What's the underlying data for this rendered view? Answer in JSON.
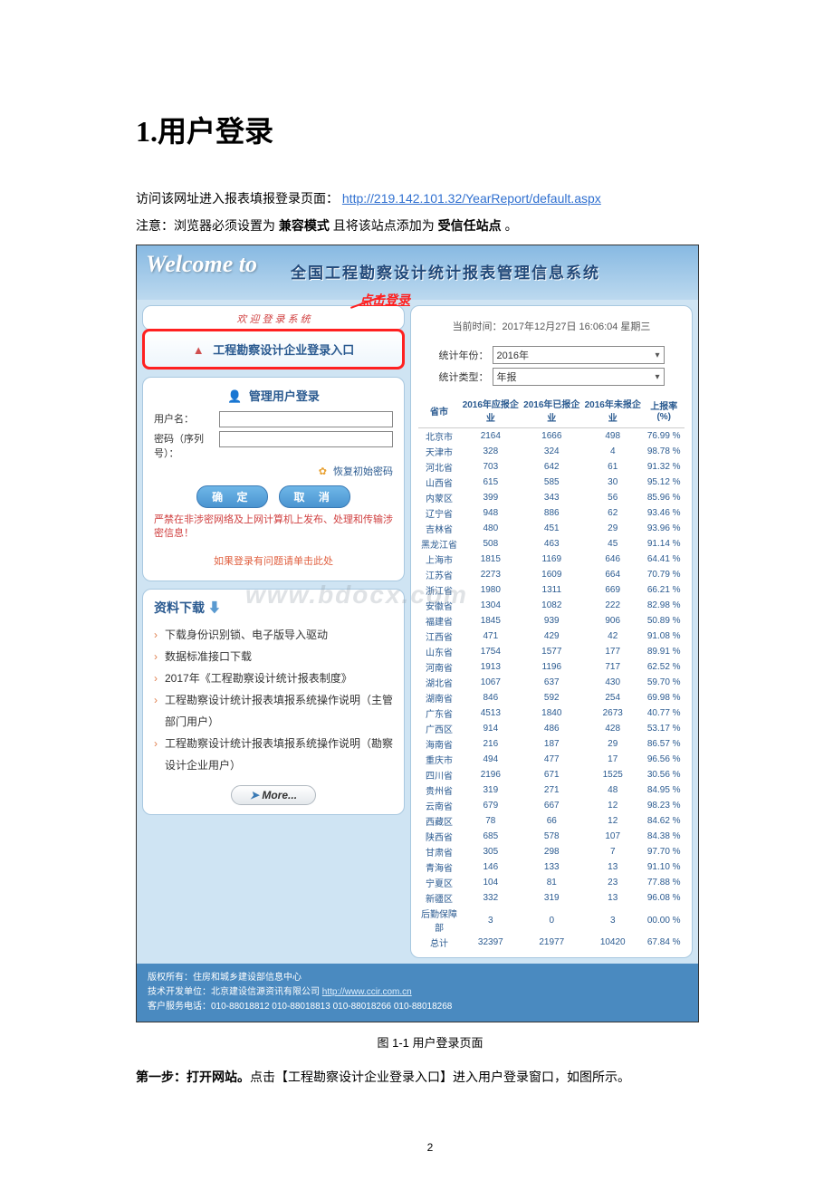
{
  "doc": {
    "heading": "1.用户登录",
    "intro1_prefix": "访问该网址进入报表填报登录页面：",
    "intro1_link": "http://219.142.101.32/YearReport/default.aspx",
    "intro2_prefix": "注意：浏览器必须设置为",
    "intro2_bold1": "兼容模式",
    "intro2_mid": "且将该站点添加为",
    "intro2_bold2": "受信任站点",
    "intro2_suffix": "。",
    "caption": "图 1-1  用户登录页面",
    "step_bold": "第一步：打开网站。",
    "step_rest": "点击【工程勘察设计企业登录入口】进入用户登录窗口，如图所示。",
    "page_num": "2"
  },
  "banner": {
    "welcome": "Welcome to",
    "system_title": "全国工程勘察设计统计报表管理信息系统"
  },
  "login_entry": {
    "label": "工程勘察设计企业登录入口",
    "callout": "点击登录",
    "welcome_strip": "欢 迎 登 录 系 统"
  },
  "admin_login": {
    "title": "管理用户登录",
    "username_label": "用户名：",
    "password_label": "密码（序列号）：",
    "reset_pw": "恢复初始密码",
    "confirm_btn": "确  定",
    "cancel_btn": "取  消",
    "warn": "严禁在非涉密网络及上网计算机上发布、处理和传输涉密信息！",
    "help": "如果登录有问题请单击此处"
  },
  "watermark": "www.bdocx.com",
  "downloads": {
    "title": "资料下载",
    "items": [
      "下载身份识别锁、电子版导入驱动",
      "数据标准接口下载",
      "2017年《工程勘察设计统计报表制度》",
      "工程勘察设计统计报表填报系统操作说明（主管部门用户）",
      "工程勘察设计统计报表填报系统操作说明（勘察设计企业用户）"
    ],
    "more": "More..."
  },
  "right": {
    "current_time": "当前时间：2017年12月27日 16:06:04 星期三",
    "year_label": "统计年份：",
    "year_value": "2016年",
    "type_label": "统计类型：",
    "type_value": "年报",
    "headers": [
      "省市",
      "2016年应报企业",
      "2016年已报企业",
      "2016年未报企业",
      "上报率(%)"
    ],
    "rows": [
      [
        "北京市",
        "2164",
        "1666",
        "498",
        "76.99 %"
      ],
      [
        "天津市",
        "328",
        "324",
        "4",
        "98.78 %"
      ],
      [
        "河北省",
        "703",
        "642",
        "61",
        "91.32 %"
      ],
      [
        "山西省",
        "615",
        "585",
        "30",
        "95.12 %"
      ],
      [
        "内蒙区",
        "399",
        "343",
        "56",
        "85.96 %"
      ],
      [
        "辽宁省",
        "948",
        "886",
        "62",
        "93.46 %"
      ],
      [
        "吉林省",
        "480",
        "451",
        "29",
        "93.96 %"
      ],
      [
        "黑龙江省",
        "508",
        "463",
        "45",
        "91.14 %"
      ],
      [
        "上海市",
        "1815",
        "1169",
        "646",
        "64.41 %"
      ],
      [
        "江苏省",
        "2273",
        "1609",
        "664",
        "70.79 %"
      ],
      [
        "浙江省",
        "1980",
        "1311",
        "669",
        "66.21 %"
      ],
      [
        "安徽省",
        "1304",
        "1082",
        "222",
        "82.98 %"
      ],
      [
        "福建省",
        "1845",
        "939",
        "906",
        "50.89 %"
      ],
      [
        "江西省",
        "471",
        "429",
        "42",
        "91.08 %"
      ],
      [
        "山东省",
        "1754",
        "1577",
        "177",
        "89.91 %"
      ],
      [
        "河南省",
        "1913",
        "1196",
        "717",
        "62.52 %"
      ],
      [
        "湖北省",
        "1067",
        "637",
        "430",
        "59.70 %"
      ],
      [
        "湖南省",
        "846",
        "592",
        "254",
        "69.98 %"
      ],
      [
        "广东省",
        "4513",
        "1840",
        "2673",
        "40.77 %"
      ],
      [
        "广西区",
        "914",
        "486",
        "428",
        "53.17 %"
      ],
      [
        "海南省",
        "216",
        "187",
        "29",
        "86.57 %"
      ],
      [
        "重庆市",
        "494",
        "477",
        "17",
        "96.56 %"
      ],
      [
        "四川省",
        "2196",
        "671",
        "1525",
        "30.56 %"
      ],
      [
        "贵州省",
        "319",
        "271",
        "48",
        "84.95 %"
      ],
      [
        "云南省",
        "679",
        "667",
        "12",
        "98.23 %"
      ],
      [
        "西藏区",
        "78",
        "66",
        "12",
        "84.62 %"
      ],
      [
        "陕西省",
        "685",
        "578",
        "107",
        "84.38 %"
      ],
      [
        "甘肃省",
        "305",
        "298",
        "7",
        "97.70 %"
      ],
      [
        "青海省",
        "146",
        "133",
        "13",
        "91.10 %"
      ],
      [
        "宁夏区",
        "104",
        "81",
        "23",
        "77.88 %"
      ],
      [
        "新疆区",
        "332",
        "319",
        "13",
        "96.08 %"
      ],
      [
        "后勤保障部",
        "3",
        "0",
        "3",
        "00.00 %"
      ],
      [
        "总计",
        "32397",
        "21977",
        "10420",
        "67.84 %"
      ]
    ]
  },
  "footer": {
    "line1": "版权所有：住房和城乡建设部信息中心",
    "line2_prefix": "技术开发单位：北京建设信源资讯有限公司    ",
    "line2_link": "http://www.ccir.com.cn",
    "line3": "客户服务电话：010-88018812 010-88018813 010-88018266 010-88018268"
  }
}
